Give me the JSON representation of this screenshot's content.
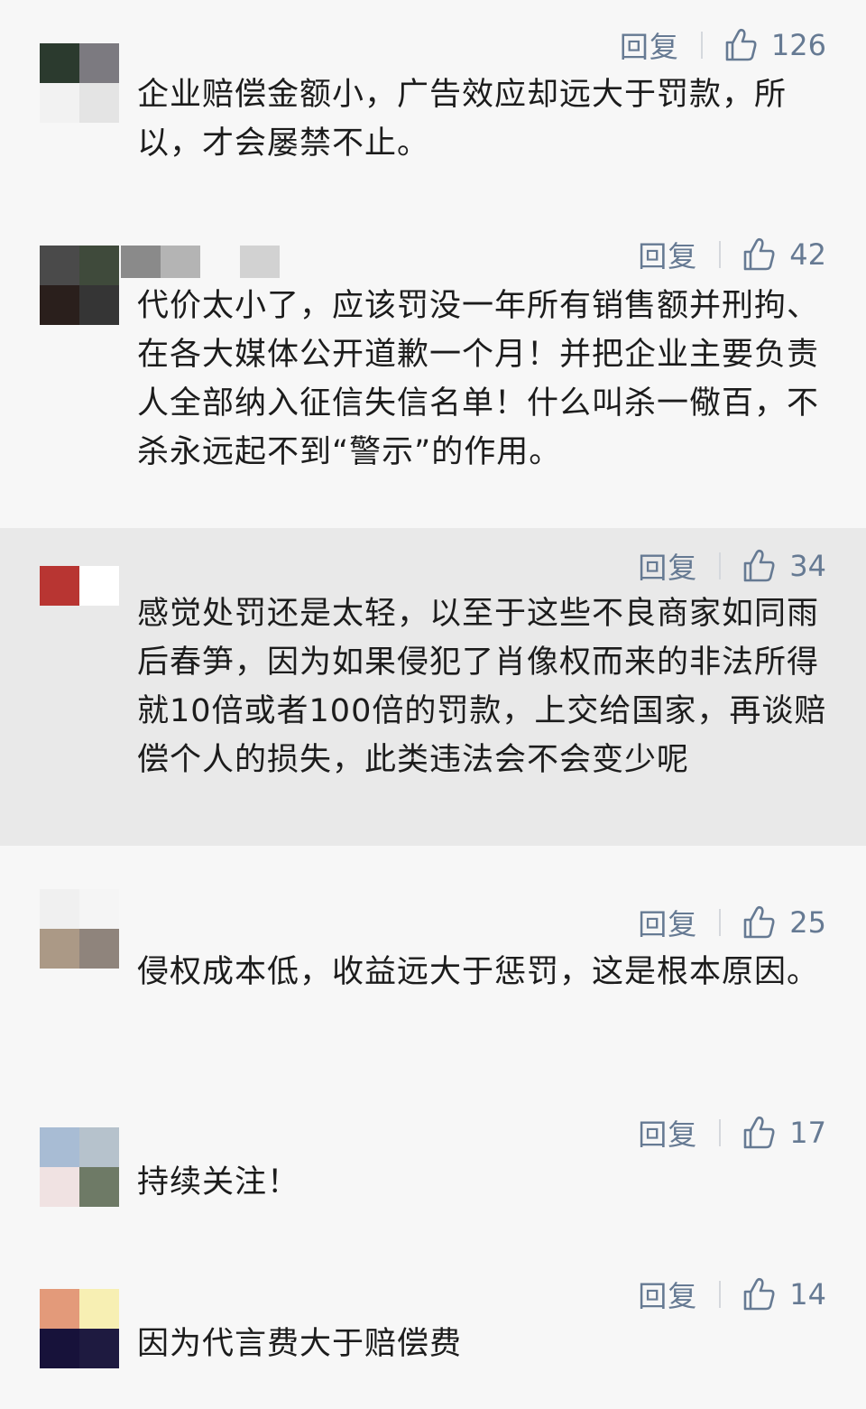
{
  "comments": [
    {
      "reply_label": "回复",
      "likes": "126",
      "text": "企业赔偿金额小，广告效应却远大于罚款，所以，才会屡禁不止。"
    },
    {
      "reply_label": "回复",
      "likes": "42",
      "text": "代价太小了，应该罚没一年所有销售额并刑拘、在各大媒体公开道歉一个月！并把企业主要负责人全部纳入征信失信名单！什么叫杀一儆百，不杀永远起不到“警示”的作用。"
    },
    {
      "reply_label": "回复",
      "likes": "34",
      "text": "感觉处罚还是太轻，以至于这些不良商家如同雨后春笋，因为如果侵犯了肖像权而来的非法所得就10倍或者100倍的罚款，上交给国家，再谈赔偿个人的损失，此类违法会不会变少呢"
    },
    {
      "reply_label": "回复",
      "likes": "25",
      "text": "侵权成本低，收益远大于惩罚，这是根本原因。"
    },
    {
      "reply_label": "回复",
      "likes": "17",
      "text": "持续关注！"
    },
    {
      "reply_label": "回复",
      "likes": "14",
      "text": "因为代言费大于赔偿费"
    }
  ],
  "icons": {
    "like": "thumbs-up-icon"
  },
  "colors": {
    "action": "#667a93",
    "text": "#1c1c1c",
    "highlight": "#e9e9e9",
    "background": "#f7f7f7"
  }
}
